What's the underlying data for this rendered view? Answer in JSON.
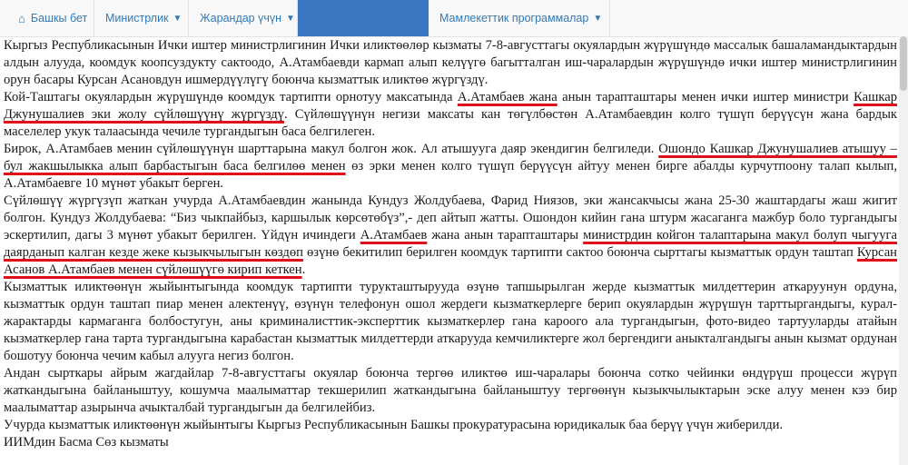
{
  "nav": {
    "home_icon": "home-icon",
    "home": "Башкы бет",
    "ministry": "Министрлик",
    "citizens": "Жарандар үчүн",
    "programs": "Мамлекеттик программалар",
    "active_color": "#3a77c0"
  },
  "article": {
    "p1": "Кыргыз Республикасынын Ички иштер министрлигинин Ички иликтөөлөр кызматы 7-8-августтагы окуялардын жүрүшүндө массалык башаламандыктардын алдын алууда, коомдук коопсуздукту сактоодо, А.Атамбаевди кармап алып келүүгө багытталган иш-чаралардын жүрүшүндө ички иштер министрлигинин орун басары Курсан Асановдун ишмердүүлүгү боюнча кызматтык иликтөө жүргүздү.",
    "p2_a": "Кой-Таштагы окуялардын жүрүшүндө коомдук тартипти орнотуу максатында ",
    "p2_u1": "А.Атамбаев жана",
    "p2_b": " анын тарапташтары менен ички иштер министри ",
    "p2_u2": "Кашкар Джунушалиев эки жолу сүйлөшүүнү жүргүздү",
    "p2_c": ". Сүйлөшүүнүн негизи максаты кан төгүлбөстөн А.Атамбаевдин колго түшүп берүүсүн жана бардык маселелер укук талаасында чечиле тургандыгын баса белгилеген.",
    "p3_a": "Бирок, А.Атамбаев менин сүйлөшүүнүн шарттарына макул болгон жок. Ал атышууга даяр экендигин белгиледи. ",
    "p3_u": "Ошондо Кашкар Джунушалиев атышуу – бул жакшылыкка алып барбастыгын баса белгилөө менен",
    "p3_b": " өз эрки менен колго түшүп берүүсүн айтуу менен бирге абалды курчутпоону талап кылып, А.Атамбаевге 10 мүнөт убакыт берген.",
    "p4_a": "Сүйлөшүү жүргүзүп жаткан учурда А.Атамбаевдин жанында Кундуз Жолдубаева, Фарид Ниязов, эки жансакчысы жана 25-30 жаштардагы жаш жигит болгон. Кундуз Жолдубаева: “Биз чыкпайбыз, каршылык көрсөтөбүз”,- деп айтып жатты. Ошондон кийин гана штурм жасаганга мажбур боло тургандыгы эскертилип, дагы 3 мүнөт убакыт берилген. Үйдүн ичиндеги ",
    "p4_u1": "А.Атамбаев",
    "p4_b": " жана анын тарапташтары ",
    "p4_u2": "министрдин койгон талаптарына макул болуп чыгууга даярданып калган кезде жеке кызыкчылыгын көздөп",
    "p4_c": " өзүнө бекитилип берилген коомдук тартипти сактоо боюнча сырттагы кызматтык ордун таштап ",
    "p4_u3": "Курсан Асанов А.Атамбаев менен сүйлөшүүгө кирип кеткен",
    "p4_d": ".",
    "p5": "Кызматтык иликтөөнүн жыйынтыгында коомдук тартипти турукташтырууда өзүнө тапшырылган жерде кызматтык милдеттерин аткаруунун ордуна, кызматтык ордун таштап пиар менен алектенүү, өзүнүн телефонун ошол жердеги кызматкерлерге берип окуялардын жүрүшүн тарттыргандыгы, курал-жарактарды кармаганга болбостугун, аны криминалисттик-эксперттик кызматкерлер гана кароого ала тургандыгын, фото-видео тартууларды атайын кызматкерлер гана тарта тургандыгына карабастан кызматтык милдеттерди аткарууда кемчиликтерге жол бергендиги аныкталгандыгы анын кызмат ордунан бошотуу боюнча чечим кабыл алууга негиз болгон.",
    "p6": "Андан сырткары айрым жагдайлар 7-8-августтагы окуялар боюнча тергөө иликтөө иш-чаралары боюнча сотко чейинки өндүрүш процесси жүрүп жаткандыгына байланыштуу, кошумча маалыматтар текшерилип жаткандыгына байланыштуу тергөөнүн кызыкчылыктарын эске алуу менен кээ бир маалыматтар азырынча ачыкталбай тургандыгын да белгилейбиз.",
    "p7": "Учурда кызматтык иликтөөнүн жыйынтыгы Кыргыз Республикасынын Башкы прокуратурасына юридикалык баа берүү үчүн жиберилди.",
    "p8": "ИИМдин Басма Сөз кызматы"
  }
}
